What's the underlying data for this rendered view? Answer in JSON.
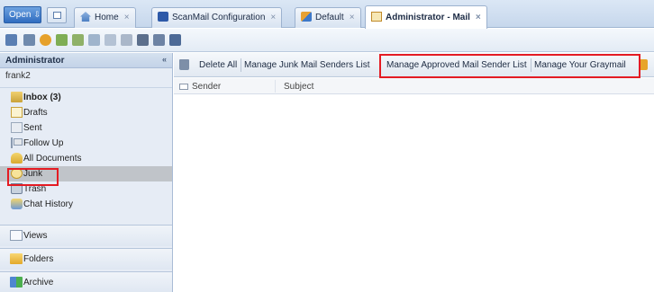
{
  "tabbar": {
    "open_label": "Open",
    "tabs": [
      {
        "label": "Home",
        "icon": "home-icon"
      },
      {
        "label": "ScanMail Configuration",
        "icon": "scanmail-icon"
      },
      {
        "label": "Default",
        "icon": "default-icon"
      },
      {
        "label": "Administrator - Mail",
        "icon": "admin-mail-icon"
      }
    ],
    "close_glyph": "×"
  },
  "sidebar": {
    "header": "Administrator",
    "collapse_glyph": "«",
    "user": "frank2",
    "items": [
      {
        "label": "Inbox (3)",
        "icon": "inbox-icon"
      },
      {
        "label": "Drafts",
        "icon": "drafts-icon"
      },
      {
        "label": "Sent",
        "icon": "sent-icon"
      },
      {
        "label": "Follow Up",
        "icon": "follow-up-icon"
      },
      {
        "label": "All Documents",
        "icon": "all-documents-icon"
      },
      {
        "label": "Junk",
        "icon": "junk-icon"
      },
      {
        "label": "Trash",
        "icon": "trash-icon"
      },
      {
        "label": "Chat History",
        "icon": "chat-history-icon"
      }
    ],
    "sections": [
      {
        "label": "Views",
        "icon": "views-icon"
      },
      {
        "label": "Folders",
        "icon": "folders-icon"
      },
      {
        "label": "Archive",
        "icon": "archive-icon"
      }
    ]
  },
  "actionbar": {
    "delete_all": "Delete All",
    "manage_junk": "Manage Junk Mail Senders List",
    "manage_approved": "Manage Approved Mail Sender List",
    "manage_graymail": "Manage Your Graymail"
  },
  "columns": {
    "sender": "Sender",
    "subject": "Subject"
  },
  "colors": {
    "highlight": "#e41b23",
    "selected_bg": "#c0c4c9"
  }
}
